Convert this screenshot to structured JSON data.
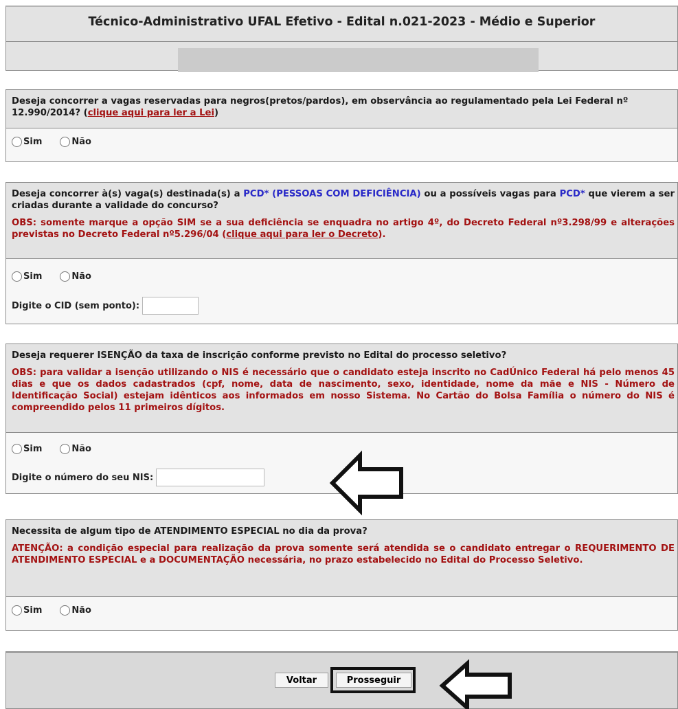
{
  "header": {
    "title": "Técnico-Administrativo UFAL Efetivo - Edital n.021-2023 - Médio e Superior"
  },
  "q1": {
    "question": "Deseja concorrer a vagas reservadas para negros(pretos/pardos), em observância ao regulamentado pela Lei Federal nº 12.990/2014? ",
    "link_text": "clique aqui para ler a Lei",
    "close_paren": ")",
    "open_paren": "(",
    "yes": "Sim",
    "no": "Não"
  },
  "q2": {
    "question_pre": "Deseja concorrer à(s) vaga(s) destinada(s) a ",
    "pcd1": "PCD* (PESSOAS COM DEFICIÊNCIA)",
    "question_mid": " ou a possíveis vagas para ",
    "pcd2": "PCD*",
    "question_post": " que vierem a ser criadas durante a validade do concurso?",
    "obs": "OBS: somente marque a opção SIM se a sua deficiência se enquadra no artigo 4º, do Decreto Federal nº3.298/99 e alterações previstas no Decreto Federal nº5.296/04 (",
    "link_text": "clique aqui para ler o Decreto",
    "obs_end": ").",
    "yes": "Sim",
    "no": "Não",
    "cid_label": "Digite o CID (sem ponto):"
  },
  "q3": {
    "question": "Deseja requerer ISENÇÃO da taxa de inscrição conforme previsto no Edital do processo seletivo?",
    "obs": "OBS: para validar a isenção utilizando o NIS é necessário que o candidato esteja inscrito no CadÚnico Federal há pelo menos 45 dias e que os dados cadastrados (cpf, nome, data de nascimento, sexo, identidade, nome da mãe e NIS - Número de Identificação Social) estejam idênticos aos informados em nosso Sistema. No Cartão do Bolsa Família o número do NIS é compreendido pelos 11 primeiros dígitos.",
    "yes": "Sim",
    "no": "Não",
    "nis_label": "Digite o número do seu NIS:"
  },
  "q4": {
    "question": "Necessita de algum tipo de ATENDIMENTO ESPECIAL no dia da prova?",
    "obs": "ATENÇÃO: a condição especial para realização da prova somente será atendida se o candidato entregar o REQUERIMENTO DE ATENDIMENTO ESPECIAL e a DOCUMENTAÇÃO necessária, no prazo estabelecido no Edital do Processo Seletivo.",
    "yes": "Sim",
    "no": "Não"
  },
  "actions": {
    "back": "Voltar",
    "next": "Prosseguir"
  },
  "colors": {
    "obs_red": "#a31212",
    "pcd_blue": "#2929c8",
    "panel_gray": "#e3e3e3"
  }
}
